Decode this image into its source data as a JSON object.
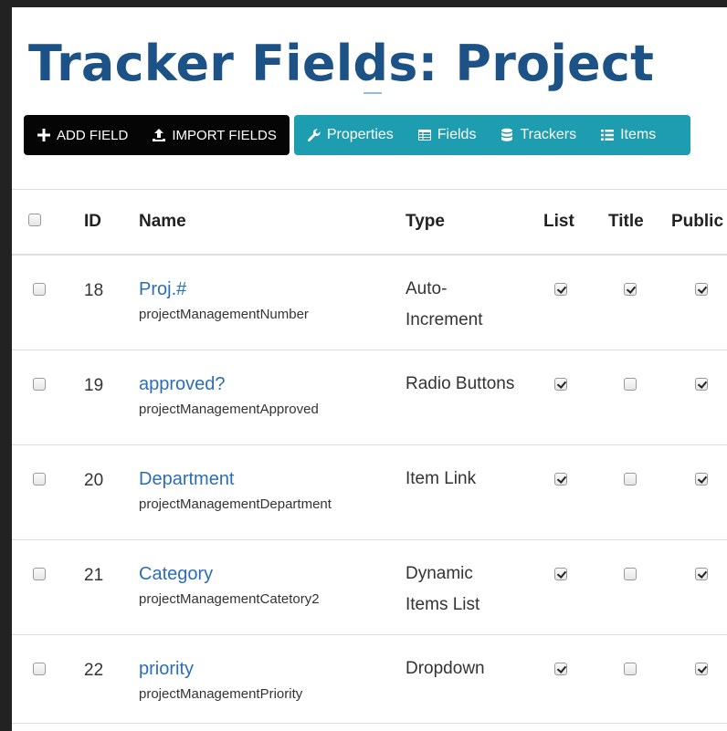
{
  "page": {
    "title": "Tracker Fields: Project"
  },
  "toolbar": {
    "add_field": "ADD FIELD",
    "import_fields": "IMPORT FIELDS",
    "properties": "Properties",
    "fields": "Fields",
    "trackers": "Trackers",
    "items": "Items"
  },
  "table": {
    "headers": {
      "id": "ID",
      "name": "Name",
      "type": "Type",
      "list": "List",
      "title": "Title",
      "public": "Public"
    },
    "rows": [
      {
        "id": "18",
        "name": "Proj.#",
        "perm": "projectManagementNumber",
        "type": "Auto-Increment",
        "list": true,
        "title": true,
        "public": true
      },
      {
        "id": "19",
        "name": "approved?",
        "perm": "projectManagementApproved",
        "type": "Radio Buttons",
        "list": true,
        "title": false,
        "public": true
      },
      {
        "id": "20",
        "name": "Department",
        "perm": "projectManagementDepartment",
        "type": "Item Link",
        "list": true,
        "title": false,
        "public": true
      },
      {
        "id": "21",
        "name": "Category",
        "perm": "projectManagementCatetory2",
        "type": "Dynamic Items List",
        "list": true,
        "title": false,
        "public": true
      },
      {
        "id": "22",
        "name": "priority",
        "perm": "projectManagementPriority",
        "type": "Dropdown",
        "list": true,
        "title": false,
        "public": true
      }
    ]
  },
  "icons": {
    "add": "plus-icon",
    "import": "upload-icon",
    "properties": "wrench-icon",
    "fields": "table-icon",
    "trackers": "database-icon",
    "items": "list-icon"
  },
  "colors": {
    "title": "#1d5287",
    "link": "#2a6ebb",
    "dark_button": "#050505",
    "teal_button": "#1e9db1",
    "backdrop": "#222222"
  }
}
